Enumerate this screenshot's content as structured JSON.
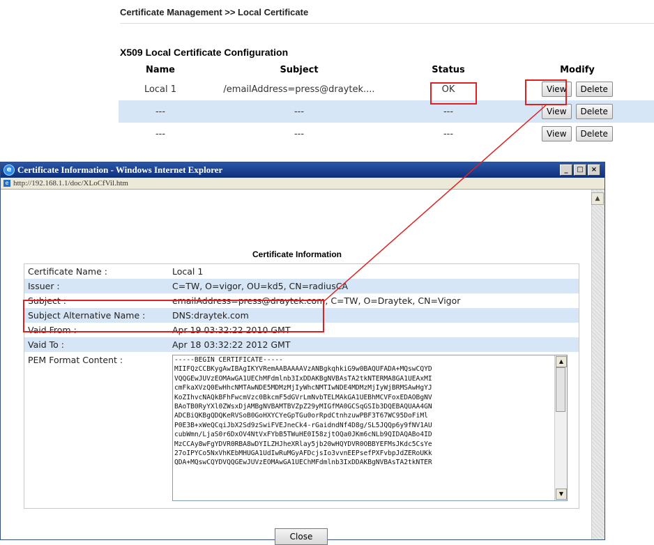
{
  "breadcrumb": "Certificate Management >> Local Certificate",
  "section_title": "X509 Local Certificate Configuration",
  "table": {
    "headers": {
      "name": "Name",
      "subject": "Subject",
      "status": "Status",
      "modify": "Modify"
    },
    "rows": [
      {
        "name": "Local 1",
        "subject": "/emailAddress=press@draytek....",
        "status": "OK",
        "view": "View",
        "delete": "Delete"
      },
      {
        "name": "---",
        "subject": "---",
        "status": "---",
        "view": "View",
        "delete": "Delete"
      },
      {
        "name": "---",
        "subject": "---",
        "status": "---",
        "view": "View",
        "delete": "Delete"
      }
    ]
  },
  "popup": {
    "window_title": "Certificate Information - Windows Internet Explorer",
    "address": "http://192.168.1.1/doc/XLoCfVil.htm",
    "controls": {
      "minimize": "_",
      "maximize": "□",
      "close": "×"
    },
    "heading": "Certificate Information",
    "fields": [
      {
        "label": "Certificate Name :",
        "value": "Local 1"
      },
      {
        "label": "Issuer :",
        "value": "C=TW, O=vigor, OU=kd5, CN=radiusCA"
      },
      {
        "label": "Subject :",
        "value": "emailAddress=press@draytek.com, C=TW, O=Draytek, CN=Vigor"
      },
      {
        "label": "Subject Alternative Name :",
        "value": "DNS:draytek.com"
      },
      {
        "label": "Vaid From :",
        "value": "Apr 19 03:32:22 2010 GMT"
      },
      {
        "label": "Vaid To :",
        "value": "Apr 18 03:32:22 2012 GMT"
      }
    ],
    "pem_label": "PEM Format Content :",
    "pem_text": "-----BEGIN CERTIFICATE-----\nMIIFQzCCBKygAwIBAgIKYVRemAABAAAAVzANBgkqhkiG9w0BAQUFADA+MQswCQYD\nVQQGEwJUVzEOMAwGA1UEChMFdmlnb3IxDDAKBgNVBAsTA2tkNTERMA8GA1UEAxMI\ncmFkaXVzQ0EwHhcNMTAwNDE5MDMzMjIyWhcNMTIwNDE4MDMzMjIyWjBRMSAwHgYJ\nKoZIhvcNAQkBFhFwcmVzc0BkcmF5dGVrLmNvbTELMAkGA1UEBhMCVFoxEDAOBgNV\nBAoTB0RyYXl0ZWsxDjAMBgNVBAMTBVZpZ29yMIGfMA0GCSqGSIb3DQEBAQUAA4GN\nADCBiQKBgQDQKeRVSoB0GoHXYCYeGpTGu0orRpdCtnhzuwPBF3T67WC95DoFiMl\nP0E3B+xWeQCqiJbX2Sd9zSwiFVEJneCk4-rGaidndNf4D8g/SL5JQQp6y9fNV1AU\ncubWmn/LjaS0r6DxOV4NtVxFYbB5TWuHE0I58zjtOQa0JKm6cNLb9QIDAQABo4ID\nMzCCAy8wFgYDVR0RBA8wDYILZHJheXRlay5jb20wHQYDVR0OBBYEFMsJKdc5CsYe\n27oIPYCo5NxVhKEbMHUGA1UdIwRuMGyAFDcjsIo3vvnEEPsefPXFvbpJdZERoUKk\nQDA+MQswCQYDVQQGEwJUVzEOMAwGA1UEChMFdmlnb3IxDDAKBgNVBAsTA2tkNTER",
    "close_label": "Close"
  },
  "colors": {
    "highlight_red": "#e02020",
    "row_blue": "#d6e6f6",
    "titlebar": "#1a3f8f"
  }
}
